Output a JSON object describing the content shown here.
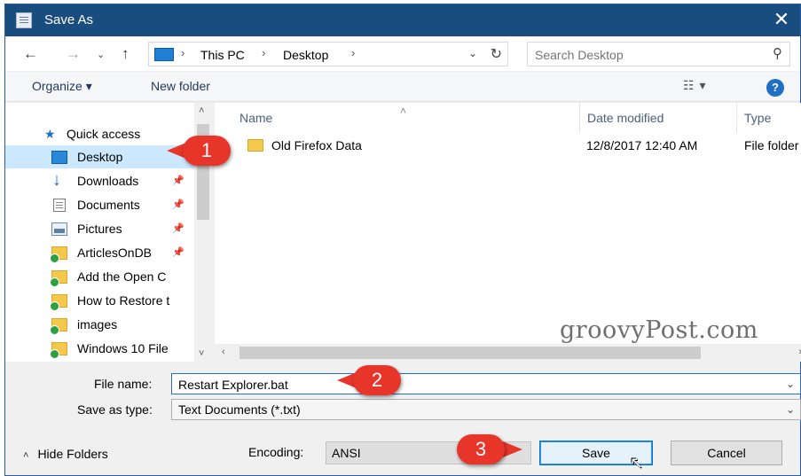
{
  "window": {
    "title": "Save As",
    "close_glyph": "✕"
  },
  "nav": {
    "back_glyph": "←",
    "forward_glyph": "→",
    "recent_glyph": "⌄",
    "up_glyph": "↑",
    "breadcrumb": [
      "This PC",
      "Desktop"
    ],
    "breadcrumb_sep": "›",
    "dropdown_glyph": "⌄",
    "refresh_glyph": "↻",
    "search_placeholder": "Search Desktop",
    "search_glyph": "⚲"
  },
  "toolbar": {
    "organize": "Organize ▾",
    "new_folder": "New folder",
    "view_glyph": "☷ ▾",
    "help": "?"
  },
  "navpane": {
    "quick_access": "Quick access",
    "items": [
      {
        "label": "Desktop",
        "icon": "desktop-icon",
        "pinned": ""
      },
      {
        "label": "Downloads",
        "icon": "downloads-icon",
        "pinned": "📌"
      },
      {
        "label": "Documents",
        "icon": "documents-icon",
        "pinned": "📌"
      },
      {
        "label": "Pictures",
        "icon": "pictures-icon",
        "pinned": "📌"
      },
      {
        "label": "ArticlesOnDB",
        "icon": "folder-icon",
        "pinned": "📌"
      },
      {
        "label": "Add the Open C",
        "icon": "folder-icon",
        "pinned": ""
      },
      {
        "label": "How to Restore t",
        "icon": "folder-icon",
        "pinned": ""
      },
      {
        "label": "images",
        "icon": "folder-icon",
        "pinned": ""
      },
      {
        "label": "Windows 10 File",
        "icon": "folder-icon",
        "pinned": ""
      }
    ],
    "scroll_up": "˄",
    "scroll_down": "˅"
  },
  "filelist": {
    "columns": {
      "name": "Name",
      "date": "Date modified",
      "type": "Type"
    },
    "sort_glyph": "˄",
    "rows": [
      {
        "name": "Old Firefox Data",
        "date": "12/8/2017 12:40 AM",
        "type": "File folder"
      }
    ],
    "scroll_left": "‹",
    "scroll_right": "›"
  },
  "watermark": "groovyPost.com",
  "form": {
    "file_name_label": "File name:",
    "file_name_value": "Restart Explorer.bat",
    "save_type_label": "Save as type:",
    "save_type_value": "Text Documents (*.txt)",
    "combo_glyph": "⌄"
  },
  "footer": {
    "hide_folders": "Hide Folders",
    "hide_glyph": "˄",
    "encoding_label": "Encoding:",
    "encoding_value": "ANSI",
    "save": "Save",
    "cancel": "Cancel",
    "cursor_glyph": "↖"
  },
  "callouts": [
    "1",
    "2",
    "3"
  ]
}
